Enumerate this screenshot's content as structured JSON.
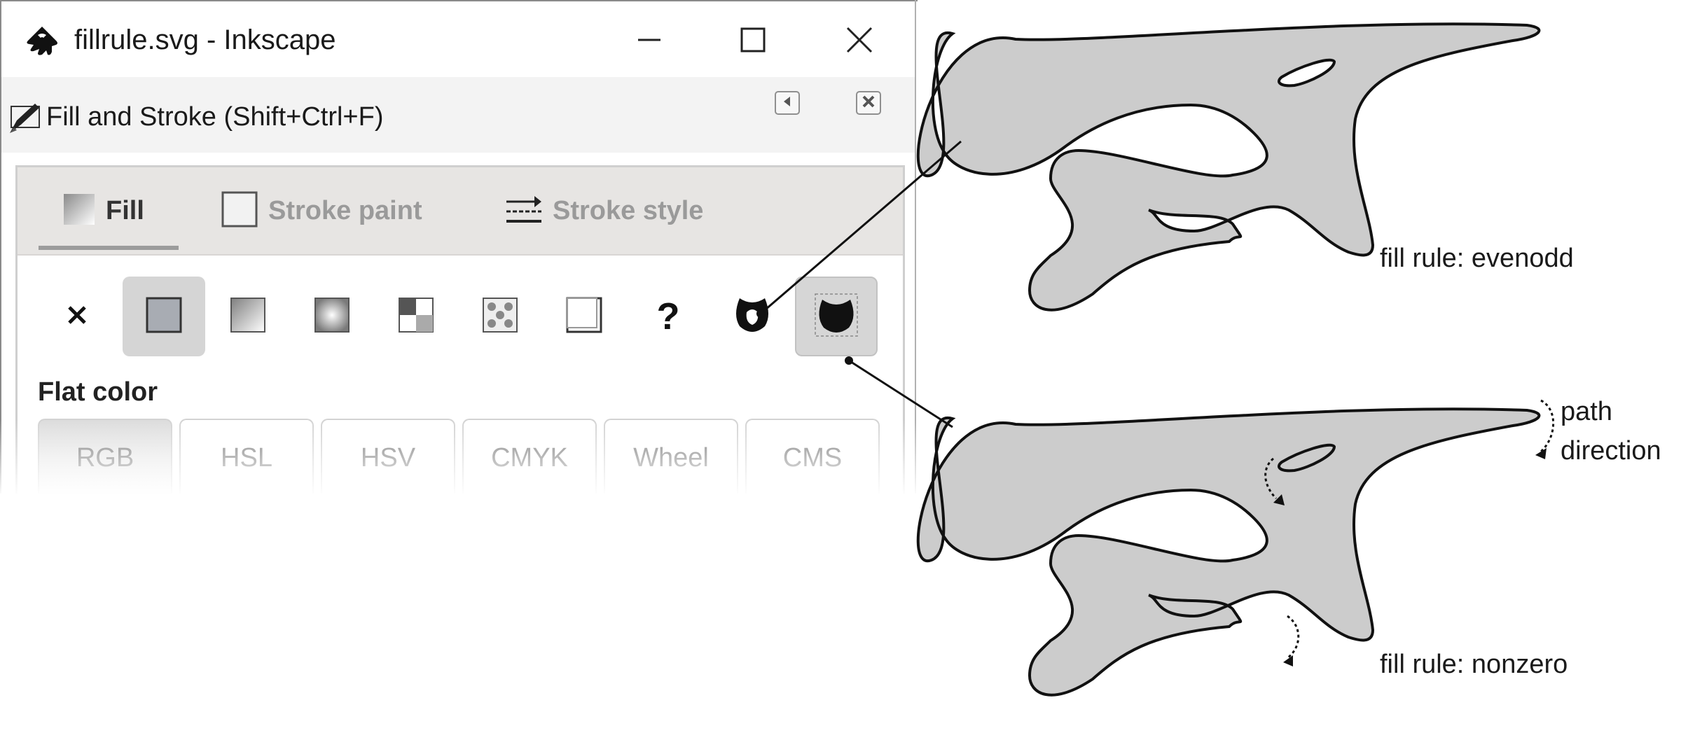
{
  "window": {
    "title": "fillrule.svg - Inkscape",
    "icon": "inkscape-logo-icon",
    "controls": [
      "minimize-icon",
      "maximize-icon",
      "close-icon"
    ]
  },
  "dialog": {
    "title": "Fill and Stroke (Shift+Ctrl+F)",
    "icon": "fill-stroke-pen-icon",
    "header_buttons": [
      "undock-arrow-icon",
      "close-dialog-icon"
    ]
  },
  "tabs": [
    {
      "label": "Fill",
      "icon": "fill-gradient-swatch-icon",
      "active": true
    },
    {
      "label": "Stroke paint",
      "icon": "stroke-paint-square-icon",
      "active": false
    },
    {
      "label": "Stroke style",
      "icon": "stroke-style-lines-icon",
      "active": false
    }
  ],
  "paint_types": [
    {
      "name": "no-paint",
      "icon": "x-icon"
    },
    {
      "name": "flat-color",
      "icon": "flat-color-swatch-icon",
      "active": true
    },
    {
      "name": "linear-gradient",
      "icon": "linear-gradient-icon"
    },
    {
      "name": "radial-gradient",
      "icon": "radial-gradient-icon"
    },
    {
      "name": "pattern",
      "icon": "pattern-icon"
    },
    {
      "name": "swatch",
      "icon": "swatch-icon"
    },
    {
      "name": "unset",
      "icon": "unset-square-icon"
    },
    {
      "name": "unknown",
      "icon": "question-icon",
      "label": "?"
    },
    {
      "name": "fill-rule-evenodd",
      "icon": "evenodd-icon"
    },
    {
      "name": "fill-rule-nonzero",
      "icon": "nonzero-icon",
      "selected": true
    }
  ],
  "flat_color_label": "Flat color",
  "color_modes": [
    {
      "label": "RGB",
      "active": true
    },
    {
      "label": "HSL"
    },
    {
      "label": "HSV"
    },
    {
      "label": "CMYK"
    },
    {
      "label": "Wheel"
    },
    {
      "label": "CMS"
    }
  ],
  "annotations": {
    "evenodd": "fill rule: evenodd",
    "nonzero": "fill rule: nonzero",
    "path_direction_line1": "path",
    "path_direction_line2": "direction"
  },
  "colors": {
    "shape_fill": "#cccccc",
    "shape_stroke": "#111111",
    "dialog_bg": "#f3f3f3",
    "tabbar_bg": "#e7e5e3"
  }
}
